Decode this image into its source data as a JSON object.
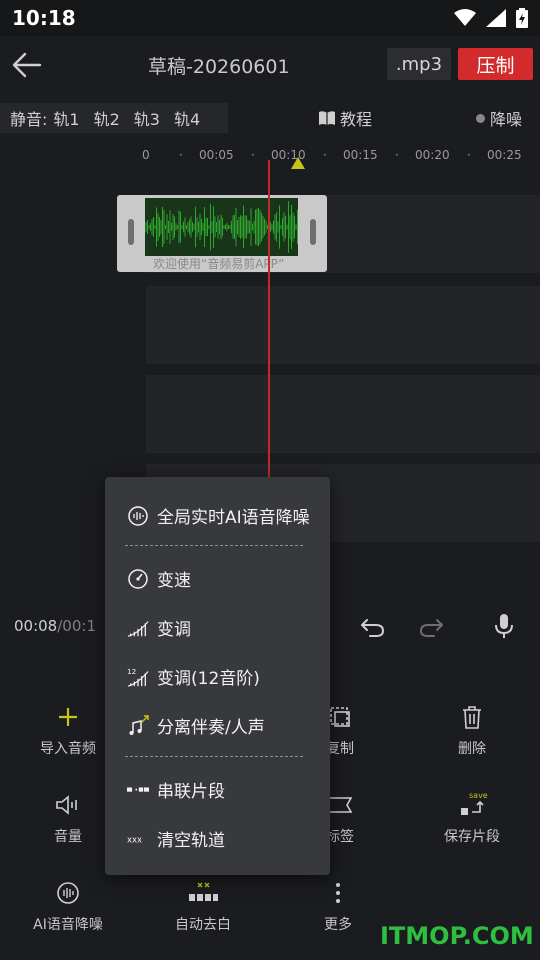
{
  "status": {
    "time": "10:18"
  },
  "header": {
    "title": "草稿-20260601",
    "format": ".mp3",
    "compress": "压制"
  },
  "mute": {
    "label": "静音:",
    "tracks": [
      "轨1",
      "轨2",
      "轨3",
      "轨4"
    ]
  },
  "tutorial": "教程",
  "denoise_toggle": "降噪",
  "ruler": {
    "ticks": [
      "0",
      "·",
      "00:05",
      "·",
      "00:10",
      "·",
      "00:15",
      "·",
      "00:20",
      "·",
      "00:25"
    ]
  },
  "clip": {
    "label": "欢迎使用“音频易剪APP”"
  },
  "playback": {
    "current": "00:08",
    "sep": "/",
    "total": "00:1"
  },
  "toolbar": {
    "import": "导入音频",
    "copy": "复制",
    "delete": "删除",
    "volume": "音量",
    "tag": "标签",
    "save_clip": "保存片段",
    "save_badge": "save",
    "ai_denoise": "AI语音降噪",
    "auto_silence": "自动去白",
    "more": "更多"
  },
  "menu": {
    "items": [
      "全局实时AI语音降噪",
      "变速",
      "变调",
      "变调(12音阶)",
      "分离伴奏/人声",
      "串联片段",
      "清空轨道"
    ],
    "pitch12_badge": "12",
    "clear_icon": "xxx"
  },
  "watermark": "ITMOP.COM",
  "colors": {
    "accent_red": "#d32b2b",
    "wave_green": "#2fa42f",
    "marker_yellow": "#c8c21a",
    "import_plus": "#c8c21a"
  }
}
